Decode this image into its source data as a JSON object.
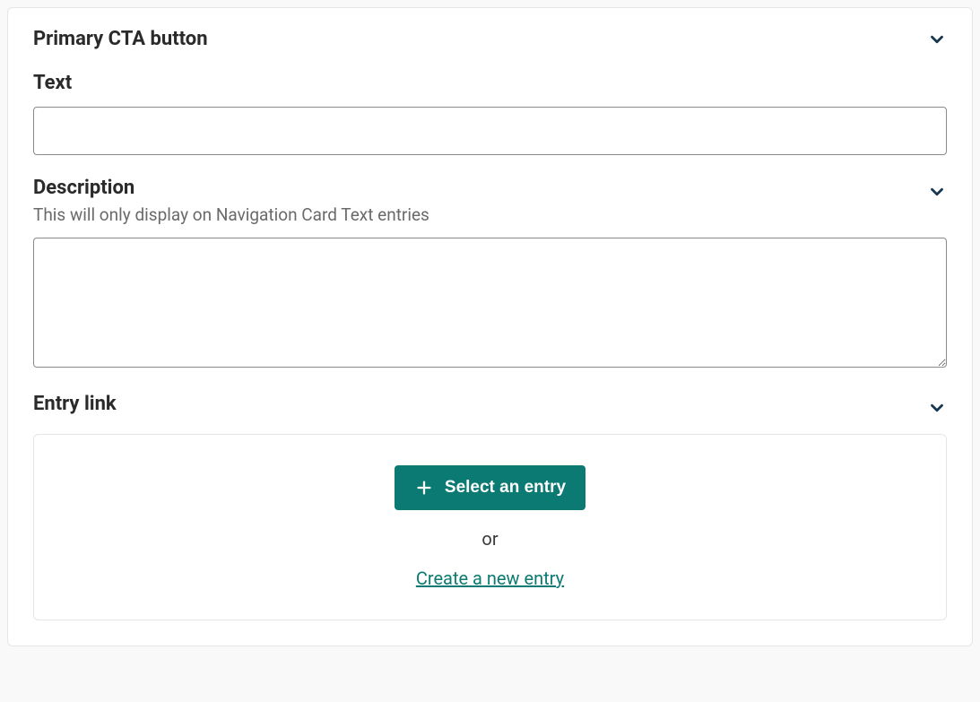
{
  "section": {
    "title": "Primary CTA button"
  },
  "fields": {
    "text": {
      "label": "Text",
      "value": ""
    },
    "description": {
      "label": "Description",
      "hint": "This will only display on Navigation Card Text entries",
      "value": ""
    },
    "entryLink": {
      "label": "Entry link",
      "selectButton": "Select an entry",
      "orText": "or",
      "createLink": "Create a new entry"
    }
  }
}
